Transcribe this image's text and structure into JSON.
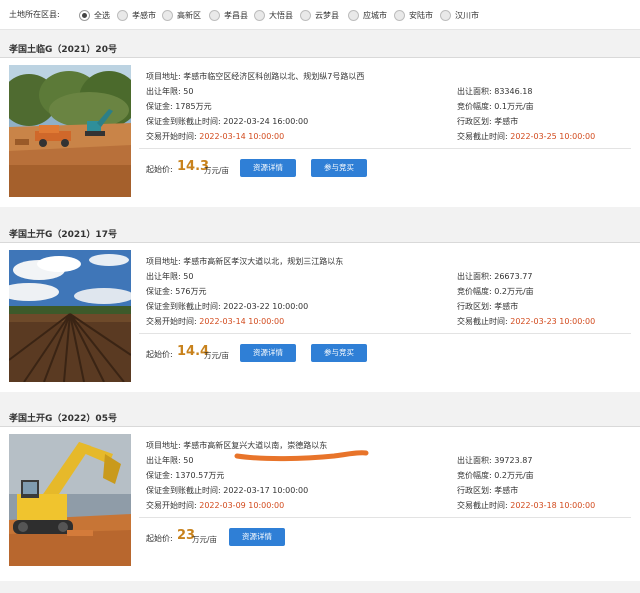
{
  "filter": {
    "label": "土地所在区县:",
    "options": [
      {
        "label": "全选",
        "checked": true
      },
      {
        "label": "孝感市",
        "checked": false
      },
      {
        "label": "高新区",
        "checked": false
      },
      {
        "label": "孝昌县",
        "checked": false
      },
      {
        "label": "大悟县",
        "checked": false
      },
      {
        "label": "云梦县",
        "checked": false
      },
      {
        "label": "应城市",
        "checked": false
      },
      {
        "label": "安陆市",
        "checked": false
      },
      {
        "label": "汉川市",
        "checked": false
      }
    ]
  },
  "labels": {
    "address": "项目地址:",
    "years": "出让年限:",
    "deposit": "保证金:",
    "deposit_deadline": "保证金到账截止时间:",
    "start": "交易开始时间:",
    "area": "出让面积:",
    "increment": "竞价幅度:",
    "region": "行政区划:",
    "end": "交易截止时间:",
    "price": "起始价:",
    "price_unit": "万元/亩",
    "detail_button": "资源详情",
    "bid_button": "参与竞买"
  },
  "listings": [
    {
      "title": "孝国土临G（2021）20号",
      "address": "孝感市临空区经济区科创路以北、规划纵7号路以西",
      "years": "50",
      "deposit": "1785万元",
      "deposit_deadline": "2022-03-24 16:00:00",
      "start": "2022-03-14 10:00:00",
      "area": "83346.18",
      "increment": "0.1万元/亩",
      "region": "孝感市",
      "end": "2022-03-25 10:00:00",
      "price": "14.3",
      "image": "construction-site-photo"
    },
    {
      "title": "孝国土开G（2021）17号",
      "address": "孝感市高新区孝汉大道以北，规划三江路以东",
      "years": "50",
      "deposit": "576万元",
      "deposit_deadline": "2022-03-22 10:00:00",
      "start": "2022-03-14 10:00:00",
      "area": "26673.77",
      "increment": "0.2万元/亩",
      "region": "孝感市",
      "end": "2022-03-23 10:00:00",
      "price": "14.4",
      "image": "farmland-photo"
    },
    {
      "title": "孝国土开G（2022）05号",
      "address": "孝感市高新区复兴大道以南，崇德路以东",
      "years": "50",
      "deposit": "1370.57万元",
      "deposit_deadline": "2022-03-17 10:00:00",
      "start": "2022-03-09 10:00:00",
      "area": "39723.87",
      "increment": "0.2万元/亩",
      "region": "孝感市",
      "end": "2022-03-18 10:00:00",
      "price": "23",
      "image": "excavator-photo",
      "annotation_color": "#e8742a"
    }
  ]
}
